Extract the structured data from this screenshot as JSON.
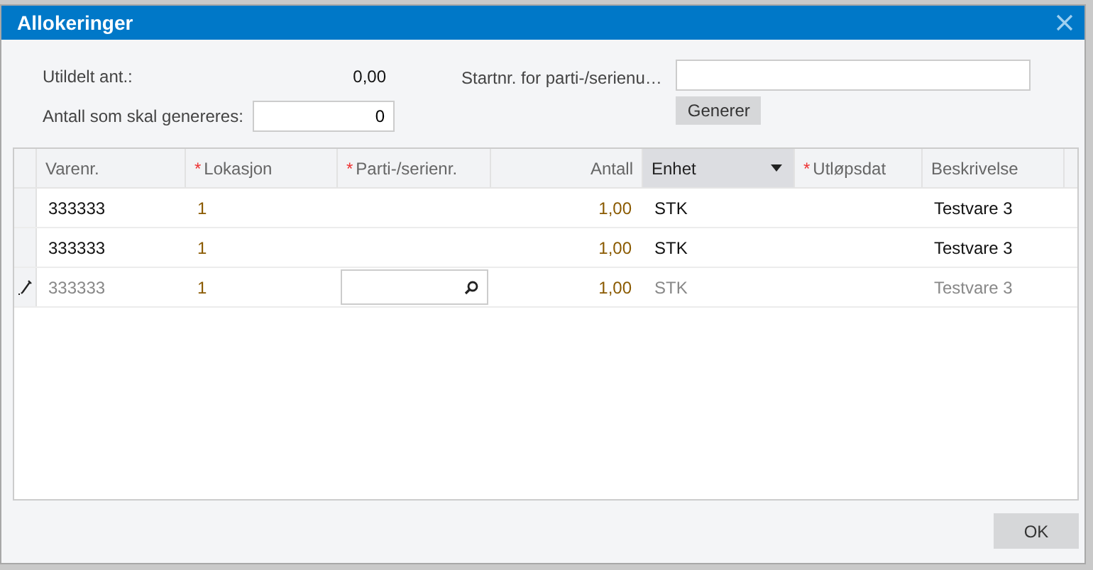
{
  "window": {
    "title": "Allokeringer"
  },
  "form": {
    "unallocated_label": "Utildelt ant.:",
    "unallocated_value": "0,00",
    "generate_count_label": "Antall som skal genereres:",
    "generate_count_value": "0",
    "start_label": "Startnr. for parti-/serienu…",
    "generate_button": "Generer"
  },
  "table": {
    "columns": [
      {
        "label": "Varenr.",
        "active": false
      },
      {
        "label": "Lokasjon",
        "required_mark": "*",
        "active": false
      },
      {
        "label": "Parti-/serienr.",
        "required_mark": "*",
        "active": false
      },
      {
        "label": "Antall",
        "active": false
      },
      {
        "label": "Enhet",
        "active": true
      },
      {
        "label": "Utløpsdat",
        "required_mark": "*",
        "active": false
      },
      {
        "label": "Beskrivelse",
        "active": false
      }
    ],
    "rows": [
      {
        "editing": false,
        "cells": [
          "333333",
          "1",
          "",
          "1,00",
          "STK",
          "",
          "Testvare 3"
        ]
      },
      {
        "editing": false,
        "cells": [
          "333333",
          "1",
          "",
          "1,00",
          "STK",
          "",
          "Testvare 3"
        ]
      },
      {
        "editing": true,
        "cells": [
          "333333",
          "1",
          "",
          "1,00",
          "STK",
          "",
          "Testvare 3"
        ]
      }
    ]
  },
  "buttons": {
    "ok": "OK"
  }
}
